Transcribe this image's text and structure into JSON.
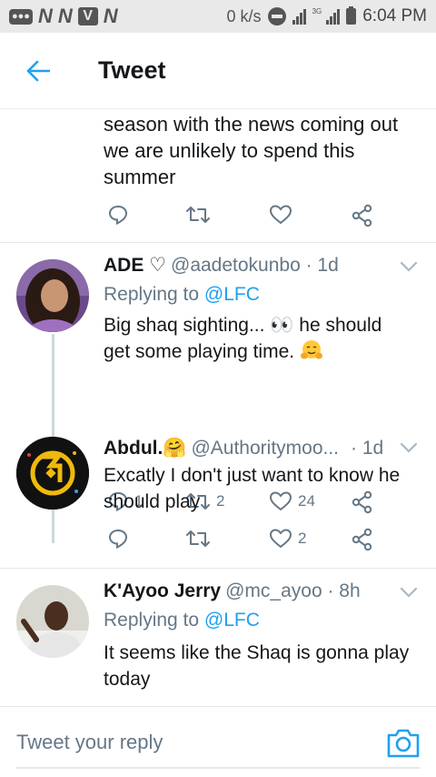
{
  "status_bar": {
    "left_badge": "●●●",
    "left_icons": [
      "N",
      "N",
      "V",
      "N"
    ],
    "net_speed": "0 k/s",
    "network": "3G",
    "time": "6:04 PM"
  },
  "appbar": {
    "title": "Tweet"
  },
  "prev_tweet": {
    "text_lines": [
      "season with the news coming out",
      "we are unlikely to spend this",
      "summer"
    ]
  },
  "replies": [
    {
      "name": "ADE ♡",
      "handle": "@aadetokunbo · 1d",
      "replying_prefix": "Replying to ",
      "replying_to": "@LFC",
      "text_line1": "Big shaq sighting... 👀 he should",
      "text_line2": "get some playing time.",
      "reply_count": "1",
      "retweet_count": "2",
      "like_count": "24"
    },
    {
      "name": "Abdul.🤗",
      "handle": "@Authoritymoo...",
      "time": "· 1d",
      "text_line1": "Excatly I don't just want to know he",
      "text_line2": "should play",
      "reply_count": "",
      "retweet_count": "",
      "like_count": "2"
    },
    {
      "name": "K'Ayoo Jerry",
      "handle": "@mc_ayoo · 8h",
      "replying_prefix": "Replying to ",
      "replying_to": "@LFC",
      "text_line1": "It seems like the Shaq is gonna play",
      "text_line2": "today"
    }
  ],
  "reply_bar": {
    "placeholder": "Tweet your reply"
  },
  "colors": {
    "accent": "#1da1f2",
    "secondary_text": "#657786",
    "divider": "#e1e8ed"
  }
}
